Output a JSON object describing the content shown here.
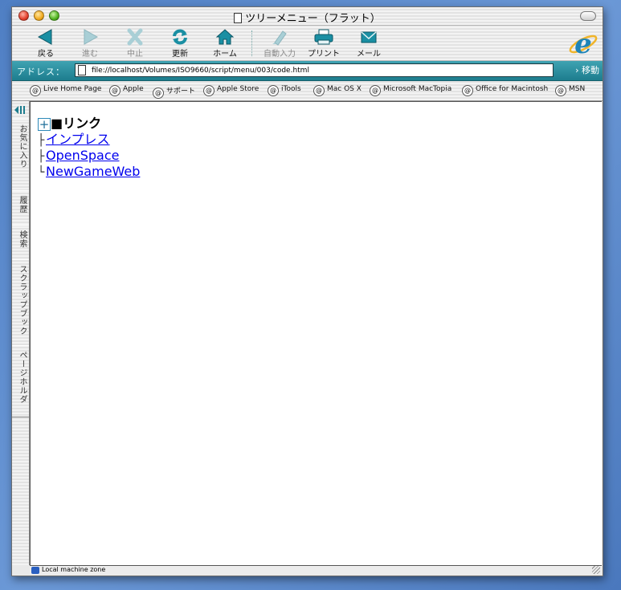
{
  "window": {
    "title": "ツリーメニュー（フラット）"
  },
  "toolbar": {
    "buttons": [
      {
        "label": "戻る",
        "icon": "back-arrow-icon",
        "enabled": true
      },
      {
        "label": "進む",
        "icon": "forward-arrow-icon",
        "enabled": false
      },
      {
        "label": "中止",
        "icon": "stop-x-icon",
        "enabled": false
      },
      {
        "label": "更新",
        "icon": "refresh-icon",
        "enabled": true
      },
      {
        "label": "ホーム",
        "icon": "home-icon",
        "enabled": true
      },
      {
        "label": "自動入力",
        "icon": "autofill-pen-icon",
        "enabled": false
      },
      {
        "label": "プリント",
        "icon": "printer-icon",
        "enabled": true
      },
      {
        "label": "メール",
        "icon": "mail-envelope-icon",
        "enabled": true
      }
    ]
  },
  "address": {
    "label": "アドレス：",
    "url": "file://localhost/Volumes/ISO9660/script/menu/003/code.html",
    "go_label": "移動"
  },
  "favorites": [
    "Live Home Page",
    "Apple",
    "サポート",
    "Apple Store",
    "iTools",
    "Mac OS X",
    "Microsoft MacTopia",
    "Office for Macintosh",
    "MSN"
  ],
  "sidebar_tabs": [
    "お気に入り",
    "履歴",
    "検索",
    "スクラップブック",
    "ページホルダ"
  ],
  "tree": {
    "expander": "+",
    "root_label": "■リンク",
    "links": [
      "インプレス",
      "OpenSpace",
      "NewGameWeb"
    ],
    "branch_mid": "├",
    "branch_last": "└"
  },
  "status": {
    "zone": "Local machine zone"
  },
  "colors": {
    "accent_teal": "#1d7d8e",
    "link": "#0000ee"
  }
}
